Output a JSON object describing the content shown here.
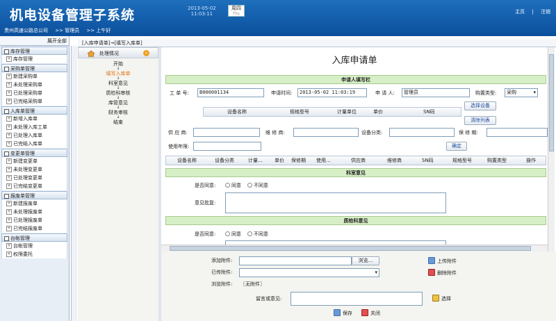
{
  "app": {
    "title": "机电设备管理子系统",
    "date": "2013-05-02",
    "time": "11:03:11",
    "weekday": "周四",
    "weekday_en": "Thu",
    "links": [
      "主页",
      "注销"
    ]
  },
  "breadcrumb": {
    "company": "贵州高速公路总公司",
    "role": ">> 管理员",
    "greet": ">> 上午好"
  },
  "sidebar": {
    "expand_all": "展开全部",
    "groups": [
      {
        "title": "库存管理",
        "items": [
          "库存管理"
        ]
      },
      {
        "title": "采购单管理",
        "items": [
          "新建采购单",
          "未处理采购单",
          "已处理采购单",
          "已完结采购单"
        ]
      },
      {
        "title": "入库单管理",
        "items": [
          "新增入库单",
          "未处理入库工单",
          "已处理入库单",
          "已完结入库单"
        ]
      },
      {
        "title": "变更单管理",
        "items": [
          "新建变更单",
          "未处理变更单",
          "已处理变更单",
          "已完结变更单"
        ]
      },
      {
        "title": "报废单管理",
        "items": [
          "新建报废单",
          "未处理报废单",
          "已处理报废单",
          "已完结报废单"
        ]
      },
      {
        "title": "台帐管理",
        "items": [
          "台帐管理",
          "权限委托"
        ]
      }
    ]
  },
  "main": {
    "path": "[入库申请单]→[填写入库单]"
  },
  "flow": {
    "header": "处理情况",
    "steps": [
      "开始",
      "填写入库单",
      "科室意见",
      "质检科审核",
      "库管意见",
      "财务审核",
      "结束"
    ],
    "active_index": 1
  },
  "form": {
    "title": "入库申请单",
    "applicant_section": "申请人填写栏",
    "work_no_label": "工 单 号:",
    "work_no": "B000001134",
    "apply_time_label": "申请时间:",
    "apply_time": "2013-05-02 11:03:19",
    "applicant_label": "申 请 人:",
    "applicant": "管理员",
    "purchase_type_label": "购置类型:",
    "purchase_type": "采购",
    "device_cols": [
      "设备名称",
      "规格型号",
      "计量单位",
      "单价",
      "SN码"
    ],
    "btn_select_device": "选择设备",
    "btn_clear_list": "清除列表",
    "supplier_label": "供 应 商:",
    "repairer_label": "维 修 商:",
    "category_label": "设备分类:",
    "warranty_label": "保 修 期:",
    "years_label": "使用年限:",
    "btn_confirm": "确定",
    "list_cols": [
      "设备名称",
      "设备分类",
      "计量...",
      "单价",
      "保修期",
      "使用...",
      "供应商",
      "维修商",
      "SN码",
      "规格型号",
      "购置类型",
      "操作"
    ],
    "dept_section": "科室意见",
    "agree_label": "是否同意:",
    "agree": "同意",
    "disagree": "不同意",
    "opinion_label": "意见批复:",
    "qc_section": "质检科意见",
    "qc_agree_label": "是否同意:"
  },
  "bottom": {
    "add_attach_label": "添加附件:",
    "browse": "浏览...",
    "upload": "上传附件",
    "uploaded_label": "已传附件:",
    "delete": "删除附件",
    "view_label": "浏览附件:",
    "no_attach": "〖无附件〗",
    "comment_label": "留言或意见:",
    "choose": "选择",
    "save": "保存",
    "close": "关闭"
  }
}
